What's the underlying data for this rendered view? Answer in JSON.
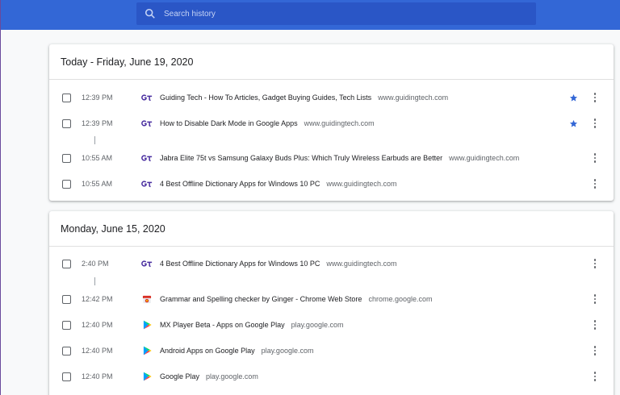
{
  "search": {
    "placeholder": "Search history",
    "value": ""
  },
  "groups": [
    {
      "header": "Today - Friday, June 19, 2020",
      "rows": [
        {
          "time": "12:39 PM",
          "title": "Guiding Tech - How To Articles, Gadget Buying Guides, Tech Lists",
          "domain": "www.guidingtech.com",
          "favicon": "guidingtech-icon",
          "starred": true
        },
        {
          "time": "12:39 PM",
          "title": "How to Disable Dark Mode in Google Apps",
          "domain": "www.guidingtech.com",
          "favicon": "guidingtech-icon",
          "starred": true
        },
        {
          "time": "10:55 AM",
          "title": "Jabra Elite 75t vs Samsung Galaxy Buds Plus: Which Truly Wireless Earbuds are Better",
          "domain": "www.guidingtech.com",
          "favicon": "guidingtech-icon",
          "starred": false
        },
        {
          "time": "10:55 AM",
          "title": "4 Best Offline Dictionary Apps for Windows 10 PC",
          "domain": "www.guidingtech.com",
          "favicon": "guidingtech-icon",
          "starred": false
        }
      ]
    },
    {
      "header": "Monday, June 15, 2020",
      "rows": [
        {
          "time": "2:40 PM",
          "title": "4 Best Offline Dictionary Apps for Windows 10 PC",
          "domain": "www.guidingtech.com",
          "favicon": "guidingtech-icon",
          "starred": false
        },
        {
          "time": "12:42 PM",
          "title": "Grammar and Spelling checker by Ginger - Chrome Web Store",
          "domain": "chrome.google.com",
          "favicon": "chrome-web-store-icon",
          "starred": false
        },
        {
          "time": "12:40 PM",
          "title": "MX Player Beta - Apps on Google Play",
          "domain": "play.google.com",
          "favicon": "google-play-icon",
          "starred": false
        },
        {
          "time": "12:40 PM",
          "title": "Android Apps on Google Play",
          "domain": "play.google.com",
          "favicon": "google-play-icon",
          "starred": false
        },
        {
          "time": "12:40 PM",
          "title": "Google Play",
          "domain": "play.google.com",
          "favicon": "google-play-icon",
          "starred": false
        }
      ]
    }
  ],
  "colors": {
    "topbar": "#3367d6",
    "star": "#3367d6",
    "background": "#f8f9fa"
  }
}
